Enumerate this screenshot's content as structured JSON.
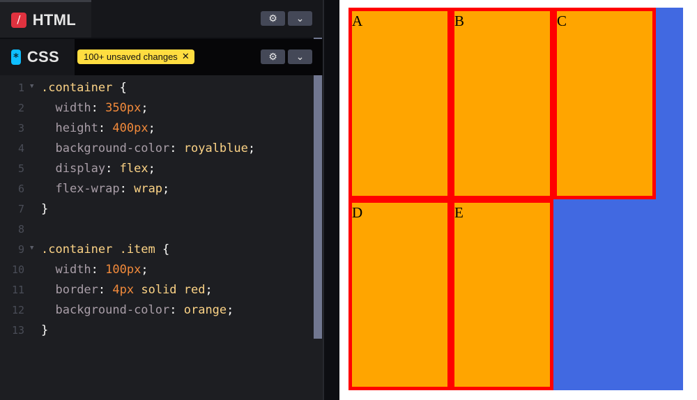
{
  "html_tab": {
    "label": "HTML",
    "badge": "/"
  },
  "css_tab": {
    "label": "CSS",
    "badge": "*",
    "unsaved": "100+ unsaved changes",
    "unsaved_close": "✕"
  },
  "controls": {
    "settings_icon": "⚙",
    "collapse_icon": "⌄"
  },
  "code": {
    "line_numbers": [
      "1",
      "2",
      "3",
      "4",
      "5",
      "6",
      "7",
      "8",
      "9",
      "10",
      "11",
      "12",
      "13"
    ],
    "lines": [
      {
        "sel": ".container",
        "tail": " {"
      },
      {
        "prop": "width",
        "val": "350px"
      },
      {
        "prop": "height",
        "val": "400px"
      },
      {
        "prop": "background-color",
        "kw": "royalblue"
      },
      {
        "prop": "display",
        "kw": "flex"
      },
      {
        "prop": "flex-wrap",
        "kw": "wrap"
      },
      {
        "close": "}"
      },
      {},
      {
        "sel": ".container .item",
        "tail": " {"
      },
      {
        "prop": "width",
        "val": "100px"
      },
      {
        "prop": "border",
        "val": "4px",
        "kw": "solid red"
      },
      {
        "prop": "background-color",
        "kw": "orange"
      },
      {
        "close": "}"
      }
    ]
  },
  "preview": {
    "items": [
      "A",
      "B",
      "C",
      "D",
      "E"
    ],
    "colors": {
      "container": "#4169e1",
      "item_bg": "#ffa500",
      "item_border": "#ff0000"
    }
  }
}
